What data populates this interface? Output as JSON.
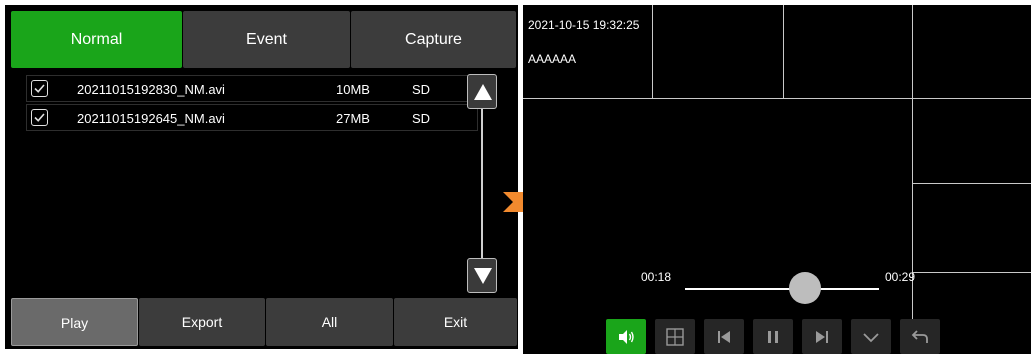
{
  "tabs": [
    {
      "label": "Normal"
    },
    {
      "label": "Event"
    },
    {
      "label": "Capture"
    }
  ],
  "files": [
    {
      "name": "20211015192830_NM.avi",
      "size": "10MB",
      "storage": "SD",
      "checked": true
    },
    {
      "name": "20211015192645_NM.avi",
      "size": "27MB",
      "storage": "SD",
      "checked": true
    }
  ],
  "bottom_buttons": [
    {
      "label": "Play"
    },
    {
      "label": "Export"
    },
    {
      "label": "All"
    },
    {
      "label": "Exit"
    }
  ],
  "player": {
    "timestamp": "2021-10-15 19:32:25",
    "channel_label": "AAAAAA",
    "current_time": "00:18",
    "total_time": "00:29",
    "progress_fraction": 0.62
  },
  "colors": {
    "accent_green": "#1aa51a",
    "arrow_orange": "#f28a2e"
  },
  "controls": [
    "volume-icon",
    "split-screen-icon",
    "previous-icon",
    "pause-icon",
    "next-icon",
    "chevron-down-icon",
    "back-icon"
  ]
}
